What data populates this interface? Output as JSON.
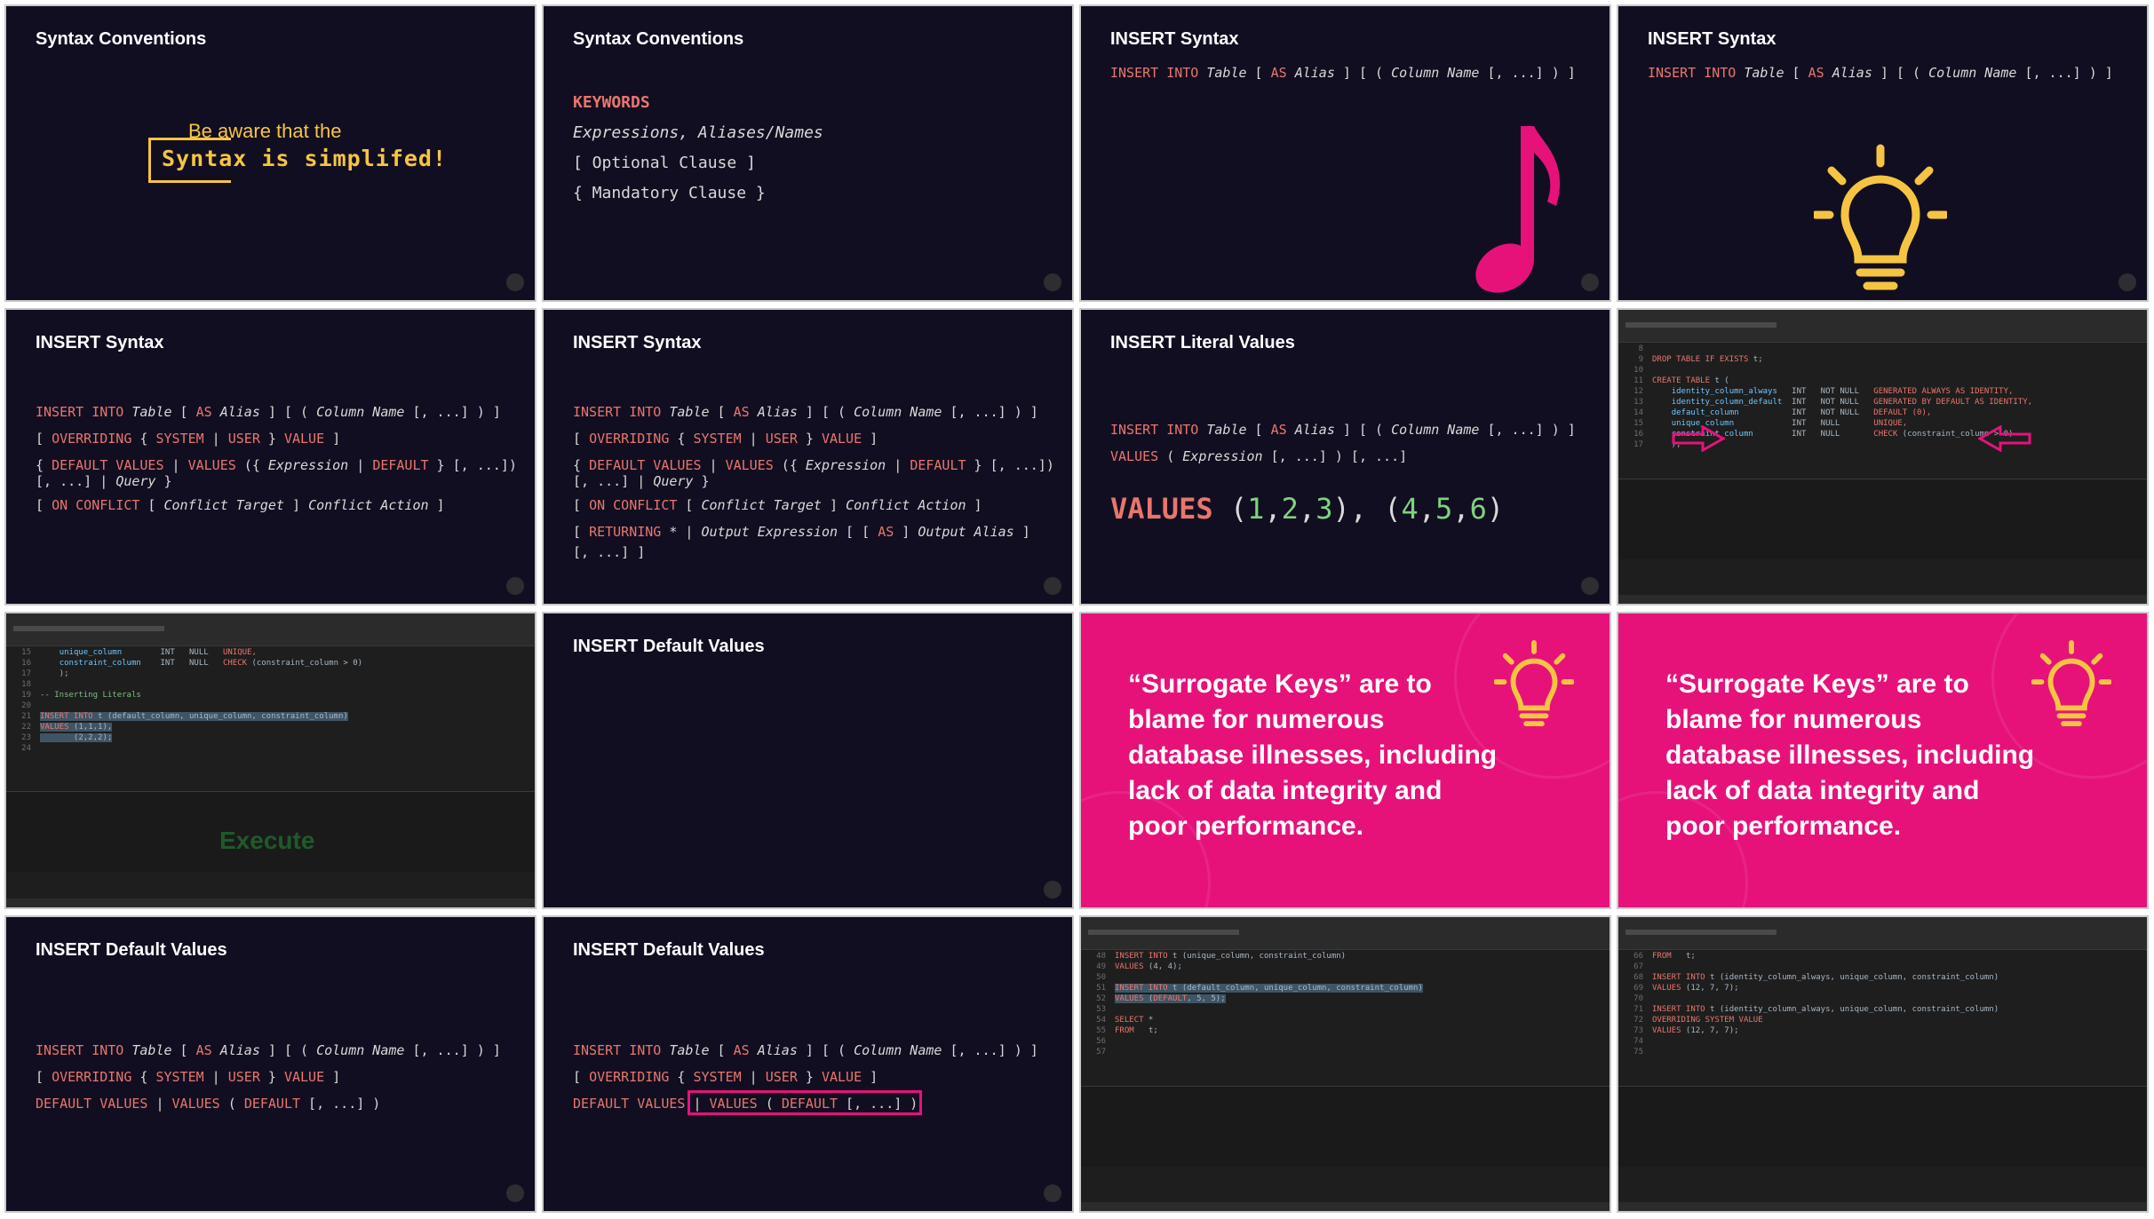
{
  "tiles": {
    "t1": {
      "title": "Syntax Conventions",
      "line1": "Be aware that the",
      "line2": "Syntax is simplifed!"
    },
    "t2": {
      "title": "Syntax Conventions",
      "keywords": "KEYWORDS",
      "expr": "Expressions, Aliases/Names",
      "optional": "[ Optional Clause ]",
      "mandatory": "{ Mandatory Clause }"
    },
    "t3": {
      "title": "INSERT Syntax",
      "icon": "music-note-icon"
    },
    "t4": {
      "title": "INSERT Syntax",
      "icon": "lightbulb-icon"
    },
    "t5": {
      "title": "INSERT Syntax"
    },
    "t6": {
      "title": "INSERT Syntax"
    },
    "t7": {
      "title": "INSERT Literal Values"
    },
    "t8": {
      "ide": true
    },
    "t9": {
      "ide": true,
      "execute": "Execute",
      "comment": "-- Inserting Literals"
    },
    "t10": {
      "title": "INSERT Default Values"
    },
    "t11": {
      "quote": "“Surrogate Keys” are to blame for numerous database illnesses, including lack of data integrity and poor performance."
    },
    "t12": {
      "quote": "“Surrogate Keys” are to blame for numerous database illnesses, including lack of data integrity and poor performance."
    },
    "t13": {
      "title": "INSERT Default Values"
    },
    "t14": {
      "title": "INSERT Default Values"
    },
    "t15": {
      "ide": true
    },
    "t16": {
      "ide": true
    }
  },
  "colors": {
    "slide_bg": "#120e21",
    "keyword": "#e8766d",
    "accent_yellow": "#f5c542",
    "accent_pink": "#e6127a",
    "number_green": "#7fd37f"
  }
}
